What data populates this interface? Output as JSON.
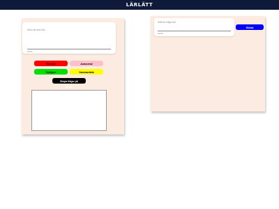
{
  "header": {
    "title": "LÄRLÄTT"
  },
  "left_panel": {
    "input_placeholder": "Skriv din text här...",
    "char_counter": "0/500",
    "buttons": {
      "red": "Förenkla",
      "pink": "Avancerad",
      "green": "Tydligare",
      "yellow": "Sammanfatta",
      "black": "Skapa frågor på texten"
    }
  },
  "right_panel": {
    "input_placeholder": "Ställ en fråga här",
    "char_counter": "0/200",
    "send_button": "Skicka"
  },
  "colors": {
    "header_bg": "#0f1a3a",
    "panel_bg": "#fcebe0",
    "red": "#ff0000",
    "pink": "#ffc0cb",
    "green": "#00e000",
    "yellow": "#ffff00",
    "black": "#000000",
    "blue": "#0000ff"
  }
}
